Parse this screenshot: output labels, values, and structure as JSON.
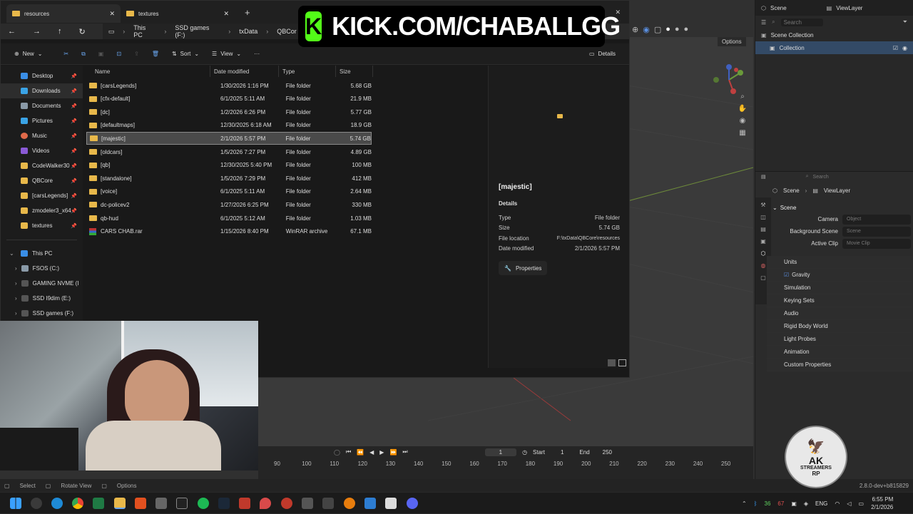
{
  "banner": {
    "text": "KICK.COM/CHABALLGG",
    "logo_letter": "K"
  },
  "explorer": {
    "tabs": [
      {
        "label": "resources",
        "active": true
      },
      {
        "label": "textures",
        "active": false
      }
    ],
    "breadcrumb": [
      "This PC",
      "SSD games (F:)",
      "txData",
      "QBCor"
    ],
    "toolbar": {
      "new_label": "New",
      "sort_label": "Sort",
      "view_label": "View",
      "more_label": "···",
      "details_label": "Details"
    },
    "nav": [
      {
        "label": "Desktop",
        "color": "#3a8ee6"
      },
      {
        "label": "Downloads",
        "color": "#3aa3e6",
        "hover": true
      },
      {
        "label": "Documents",
        "color": "#8a9aa8"
      },
      {
        "label": "Pictures",
        "color": "#3aa3e6"
      },
      {
        "label": "Music",
        "color": "#e06a4a"
      },
      {
        "label": "Videos",
        "color": "#8a5ad6"
      },
      {
        "label": "CodeWalker30",
        "color": "#e8b84a"
      },
      {
        "label": "QBCore",
        "color": "#e8b84a"
      },
      {
        "label": "[carsLegends]",
        "color": "#e8b84a"
      },
      {
        "label": "zmodeler3_x64",
        "color": "#e8b84a"
      },
      {
        "label": "textures",
        "color": "#e8b84a"
      }
    ],
    "tree": [
      {
        "label": "This PC"
      },
      {
        "label": "FSOS (C:)"
      },
      {
        "label": "GAMING NVME (I"
      },
      {
        "label": "SSD I9dim (E:)"
      },
      {
        "label": "SSD games (F:)"
      }
    ],
    "columns": {
      "name": "Name",
      "date": "Date modified",
      "type": "Type",
      "size": "Size"
    },
    "files": [
      {
        "name": "[carsLegends]",
        "date": "1/30/2026 1:16 PM",
        "type": "File folder",
        "size": "5.68 GB",
        "icon": "folder"
      },
      {
        "name": "[cfx-default]",
        "date": "6/1/2025 5:11 AM",
        "type": "File folder",
        "size": "21.9 MB",
        "icon": "folder"
      },
      {
        "name": "[dc]",
        "date": "1/2/2026 6:26 PM",
        "type": "File folder",
        "size": "5.77 GB",
        "icon": "folder"
      },
      {
        "name": "[defaultmaps]",
        "date": "12/30/2025 6:18 AM",
        "type": "File folder",
        "size": "18.9 GB",
        "icon": "folder"
      },
      {
        "name": "[majestic]",
        "date": "2/1/2026 5:57 PM",
        "type": "File folder",
        "size": "5.74 GB",
        "icon": "folder",
        "selected": true
      },
      {
        "name": "[oldcars]",
        "date": "1/5/2026 7:27 PM",
        "type": "File folder",
        "size": "4.89 GB",
        "icon": "folder"
      },
      {
        "name": "[qb]",
        "date": "12/30/2025 5:40 PM",
        "type": "File folder",
        "size": "100 MB",
        "icon": "folder"
      },
      {
        "name": "[standalone]",
        "date": "1/5/2026 7:29 PM",
        "type": "File folder",
        "size": "412 MB",
        "icon": "folder"
      },
      {
        "name": "[voice]",
        "date": "6/1/2025 5:11 AM",
        "type": "File folder",
        "size": "2.64 MB",
        "icon": "folder"
      },
      {
        "name": "dc-policev2",
        "date": "1/27/2026 6:25 PM",
        "type": "File folder",
        "size": "330 MB",
        "icon": "folder"
      },
      {
        "name": "qb-hud",
        "date": "6/1/2025 5:12 AM",
        "type": "File folder",
        "size": "1.03 MB",
        "icon": "folder"
      },
      {
        "name": "CARS CHAB.rar",
        "date": "1/15/2026 8:40 PM",
        "type": "WinRAR archive",
        "size": "67.1 MB",
        "icon": "rar"
      }
    ],
    "details_pane": {
      "title": "[majestic]",
      "section": "Details",
      "rows": [
        {
          "k": "Type",
          "v": "File folder"
        },
        {
          "k": "Size",
          "v": "5.74 GB"
        },
        {
          "k": "File location",
          "v": "F:\\txData\\QBCore\\resources"
        },
        {
          "k": "Date modified",
          "v": "2/1/2026 5:57 PM"
        }
      ],
      "properties_label": "Properties"
    }
  },
  "blender": {
    "header_options": "Options",
    "top_scene": "Scene",
    "top_viewlayer": "ViewLayer",
    "search_placeholder": "Search",
    "outliner": {
      "root": "Scene Collection",
      "child": "Collection"
    },
    "props_breadcrumb": [
      "Scene",
      "ViewLayer"
    ],
    "scene_section": "Scene",
    "fields": [
      {
        "label": "Camera",
        "placeholder": "Object"
      },
      {
        "label": "Background Scene",
        "placeholder": "Scene"
      },
      {
        "label": "Active Clip",
        "placeholder": "Movie Clip"
      }
    ],
    "panels": [
      "Units",
      "Gravity",
      "Simulation",
      "Keying Sets",
      "Audio",
      "Rigid Body World",
      "Light Probes",
      "Animation",
      "Custom Properties"
    ],
    "timeline": {
      "frame": "1",
      "start_label": "Start",
      "start": "1",
      "end_label": "End",
      "end": "250",
      "ticks": [
        "90",
        "100",
        "110",
        "120",
        "130",
        "140",
        "150",
        "160",
        "170",
        "180",
        "190",
        "200",
        "210",
        "220",
        "230",
        "240",
        "250"
      ]
    },
    "status": {
      "select": "Select",
      "rotate": "Rotate View",
      "options": "Options",
      "version": "2.8.0-dev+b815829"
    }
  },
  "watermark": {
    "line1": "AK",
    "line2": "STREAMERS",
    "line3": "RP"
  },
  "taskbar": {
    "tray_nums": [
      "36",
      "67"
    ],
    "lang": "ENG",
    "time": "6:55 PM",
    "date": "2/1/2026"
  }
}
